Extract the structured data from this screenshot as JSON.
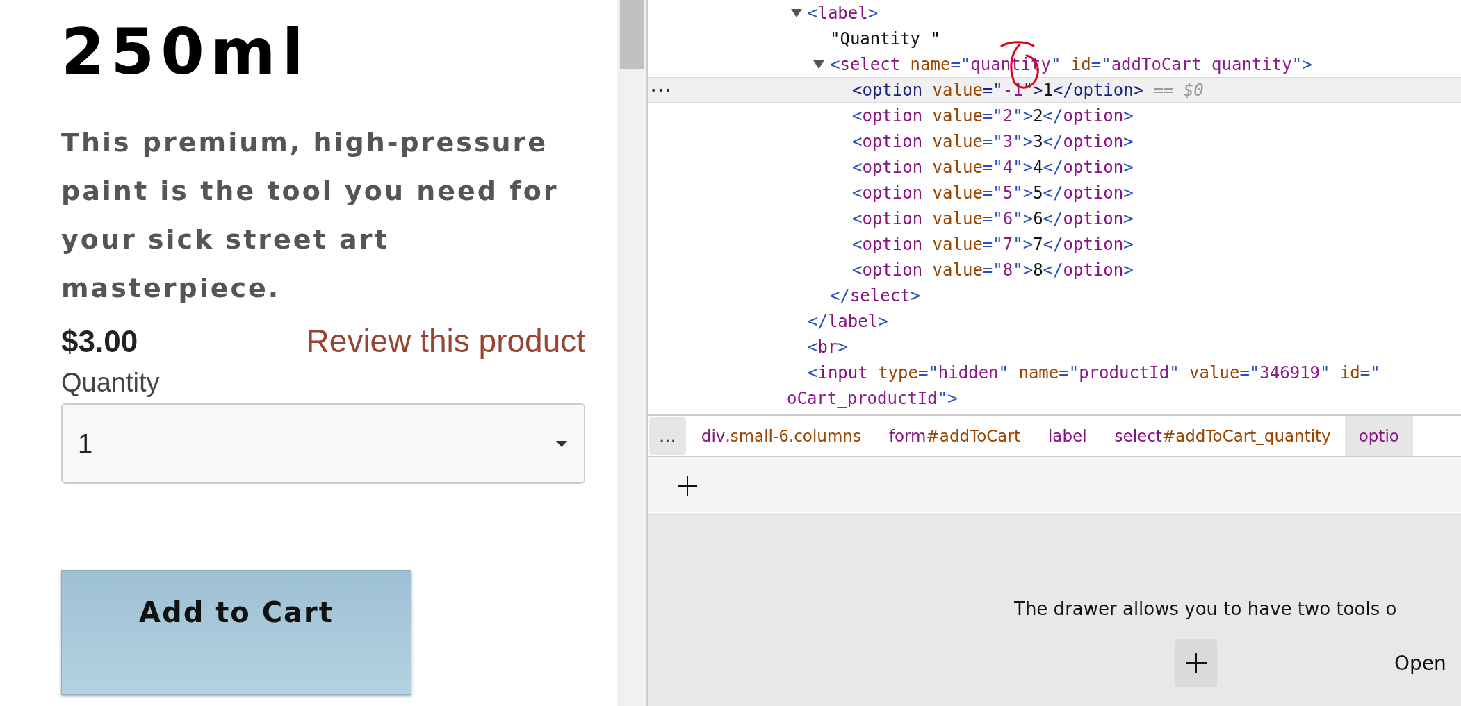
{
  "product": {
    "title": "250ml",
    "description": "This premium, high-pressure paint is the tool you need for your sick street art masterpiece.",
    "price": "$3.00",
    "review_link": "Review this product",
    "quantity_label": "Quantity",
    "quantity_value": "1",
    "add_button": "Add to Cart"
  },
  "elements_tree": [
    {
      "tokens": [
        {
          "kind": "punct",
          "text": "<"
        },
        {
          "kind": "tag",
          "text": "label"
        },
        {
          "kind": "punct",
          "text": ">"
        }
      ],
      "expanded": true,
      "selected": false,
      "children": [
        {
          "tokens": [
            {
              "kind": "text",
              "text": "\"Quantity \""
            }
          ],
          "selected": false
        },
        {
          "tokens": [
            {
              "kind": "punct",
              "text": "<"
            },
            {
              "kind": "tag",
              "text": "select"
            },
            {
              "kind": "attr",
              "text": " name"
            },
            {
              "kind": "punct",
              "text": "=\""
            },
            {
              "kind": "value",
              "text": "quantity"
            },
            {
              "kind": "punct",
              "text": "\""
            },
            {
              "kind": "attr",
              "text": " id"
            },
            {
              "kind": "punct",
              "text": "=\""
            },
            {
              "kind": "value",
              "text": "addToCart_quantity"
            },
            {
              "kind": "punct",
              "text": "\">"
            }
          ],
          "expanded": true,
          "selected": false,
          "children": [
            {
              "tokens": [
                {
                  "kind": "punct",
                  "text": "<"
                },
                {
                  "kind": "tag",
                  "text": "option"
                },
                {
                  "kind": "attr",
                  "text": " value"
                },
                {
                  "kind": "punct",
                  "text": "=\""
                },
                {
                  "kind": "value",
                  "text": "-1"
                },
                {
                  "kind": "punct",
                  "text": "\">"
                },
                {
                  "kind": "text",
                  "text": "1"
                },
                {
                  "kind": "punct",
                  "text": "</"
                },
                {
                  "kind": "tag",
                  "text": "option"
                },
                {
                  "kind": "punct",
                  "text": ">"
                },
                {
                  "kind": "hint",
                  "text": " == $0"
                }
              ],
              "menu": "•••",
              "selected": true
            },
            {
              "tokens": [
                {
                  "kind": "punct",
                  "text": "<"
                },
                {
                  "kind": "tag",
                  "text": "option"
                },
                {
                  "kind": "attr",
                  "text": " value"
                },
                {
                  "kind": "punct",
                  "text": "=\""
                },
                {
                  "kind": "value",
                  "text": "2"
                },
                {
                  "kind": "punct",
                  "text": "\">"
                },
                {
                  "kind": "text",
                  "text": "2"
                },
                {
                  "kind": "punct",
                  "text": "</"
                },
                {
                  "kind": "tag",
                  "text": "option"
                },
                {
                  "kind": "punct",
                  "text": ">"
                }
              ],
              "selected": false
            },
            {
              "tokens": [
                {
                  "kind": "punct",
                  "text": "<"
                },
                {
                  "kind": "tag",
                  "text": "option"
                },
                {
                  "kind": "attr",
                  "text": " value"
                },
                {
                  "kind": "punct",
                  "text": "=\""
                },
                {
                  "kind": "value",
                  "text": "3"
                },
                {
                  "kind": "punct",
                  "text": "\">"
                },
                {
                  "kind": "text",
                  "text": "3"
                },
                {
                  "kind": "punct",
                  "text": "</"
                },
                {
                  "kind": "tag",
                  "text": "option"
                },
                {
                  "kind": "punct",
                  "text": ">"
                }
              ],
              "selected": false
            },
            {
              "tokens": [
                {
                  "kind": "punct",
                  "text": "<"
                },
                {
                  "kind": "tag",
                  "text": "option"
                },
                {
                  "kind": "attr",
                  "text": " value"
                },
                {
                  "kind": "punct",
                  "text": "=\""
                },
                {
                  "kind": "value",
                  "text": "4"
                },
                {
                  "kind": "punct",
                  "text": "\">"
                },
                {
                  "kind": "text",
                  "text": "4"
                },
                {
                  "kind": "punct",
                  "text": "</"
                },
                {
                  "kind": "tag",
                  "text": "option"
                },
                {
                  "kind": "punct",
                  "text": ">"
                }
              ],
              "selected": false
            },
            {
              "tokens": [
                {
                  "kind": "punct",
                  "text": "<"
                },
                {
                  "kind": "tag",
                  "text": "option"
                },
                {
                  "kind": "attr",
                  "text": " value"
                },
                {
                  "kind": "punct",
                  "text": "=\""
                },
                {
                  "kind": "value",
                  "text": "5"
                },
                {
                  "kind": "punct",
                  "text": "\">"
                },
                {
                  "kind": "text",
                  "text": "5"
                },
                {
                  "kind": "punct",
                  "text": "</"
                },
                {
                  "kind": "tag",
                  "text": "option"
                },
                {
                  "kind": "punct",
                  "text": ">"
                }
              ],
              "selected": false
            },
            {
              "tokens": [
                {
                  "kind": "punct",
                  "text": "<"
                },
                {
                  "kind": "tag",
                  "text": "option"
                },
                {
                  "kind": "attr",
                  "text": " value"
                },
                {
                  "kind": "punct",
                  "text": "=\""
                },
                {
                  "kind": "value",
                  "text": "6"
                },
                {
                  "kind": "punct",
                  "text": "\">"
                },
                {
                  "kind": "text",
                  "text": "6"
                },
                {
                  "kind": "punct",
                  "text": "</"
                },
                {
                  "kind": "tag",
                  "text": "option"
                },
                {
                  "kind": "punct",
                  "text": ">"
                }
              ],
              "selected": false
            },
            {
              "tokens": [
                {
                  "kind": "punct",
                  "text": "<"
                },
                {
                  "kind": "tag",
                  "text": "option"
                },
                {
                  "kind": "attr",
                  "text": " value"
                },
                {
                  "kind": "punct",
                  "text": "=\""
                },
                {
                  "kind": "value",
                  "text": "7"
                },
                {
                  "kind": "punct",
                  "text": "\">"
                },
                {
                  "kind": "text",
                  "text": "7"
                },
                {
                  "kind": "punct",
                  "text": "</"
                },
                {
                  "kind": "tag",
                  "text": "option"
                },
                {
                  "kind": "punct",
                  "text": ">"
                }
              ],
              "selected": false
            },
            {
              "tokens": [
                {
                  "kind": "punct",
                  "text": "<"
                },
                {
                  "kind": "tag",
                  "text": "option"
                },
                {
                  "kind": "attr",
                  "text": " value"
                },
                {
                  "kind": "punct",
                  "text": "=\""
                },
                {
                  "kind": "value",
                  "text": "8"
                },
                {
                  "kind": "punct",
                  "text": "\">"
                },
                {
                  "kind": "text",
                  "text": "8"
                },
                {
                  "kind": "punct",
                  "text": "</"
                },
                {
                  "kind": "tag",
                  "text": "option"
                },
                {
                  "kind": "punct",
                  "text": ">"
                }
              ],
              "selected": false
            }
          ]
        },
        {
          "tokens": [
            {
              "kind": "punct",
              "text": "</"
            },
            {
              "kind": "tag",
              "text": "select"
            },
            {
              "kind": "punct",
              "text": ">"
            }
          ],
          "selected": false
        }
      ]
    },
    {
      "tokens": [
        {
          "kind": "punct",
          "text": "</"
        },
        {
          "kind": "tag",
          "text": "label"
        },
        {
          "kind": "punct",
          "text": ">"
        }
      ],
      "selected": false
    },
    {
      "tokens": [
        {
          "kind": "punct",
          "text": "<"
        },
        {
          "kind": "tag",
          "text": "br"
        },
        {
          "kind": "punct",
          "text": ">"
        }
      ],
      "selected": false
    },
    {
      "tokens": [
        {
          "kind": "punct",
          "text": "<"
        },
        {
          "kind": "tag",
          "text": "input"
        },
        {
          "kind": "attr",
          "text": " type"
        },
        {
          "kind": "punct",
          "text": "=\""
        },
        {
          "kind": "value",
          "text": "hidden"
        },
        {
          "kind": "punct",
          "text": "\""
        },
        {
          "kind": "attr",
          "text": " name"
        },
        {
          "kind": "punct",
          "text": "=\""
        },
        {
          "kind": "value",
          "text": "productId"
        },
        {
          "kind": "punct",
          "text": "\""
        },
        {
          "kind": "attr",
          "text": " value"
        },
        {
          "kind": "punct",
          "text": "=\""
        },
        {
          "kind": "value",
          "text": "346919"
        },
        {
          "kind": "punct",
          "text": "\""
        },
        {
          "kind": "attr",
          "text": " id"
        },
        {
          "kind": "punct",
          "text": "=\""
        }
      ],
      "continuation": [
        {
          "kind": "value",
          "text": "oCart_productId"
        },
        {
          "kind": "punct",
          "text": "\">"
        }
      ],
      "selected": false
    }
  ],
  "breadcrumbs": {
    "more": "...",
    "items": [
      {
        "tag": "div",
        "rest": ".small-6.columns",
        "selected": false
      },
      {
        "tag": "form",
        "rest": "#addToCart",
        "selected": false
      },
      {
        "tag": "label",
        "selected": false
      },
      {
        "tag": "select",
        "rest": "#addToCart_quantity",
        "selected": false
      },
      {
        "tag": "optio",
        "selected": true
      }
    ]
  },
  "drawer": {
    "message": "The drawer allows you to have two tools o",
    "open_label": "Open"
  }
}
